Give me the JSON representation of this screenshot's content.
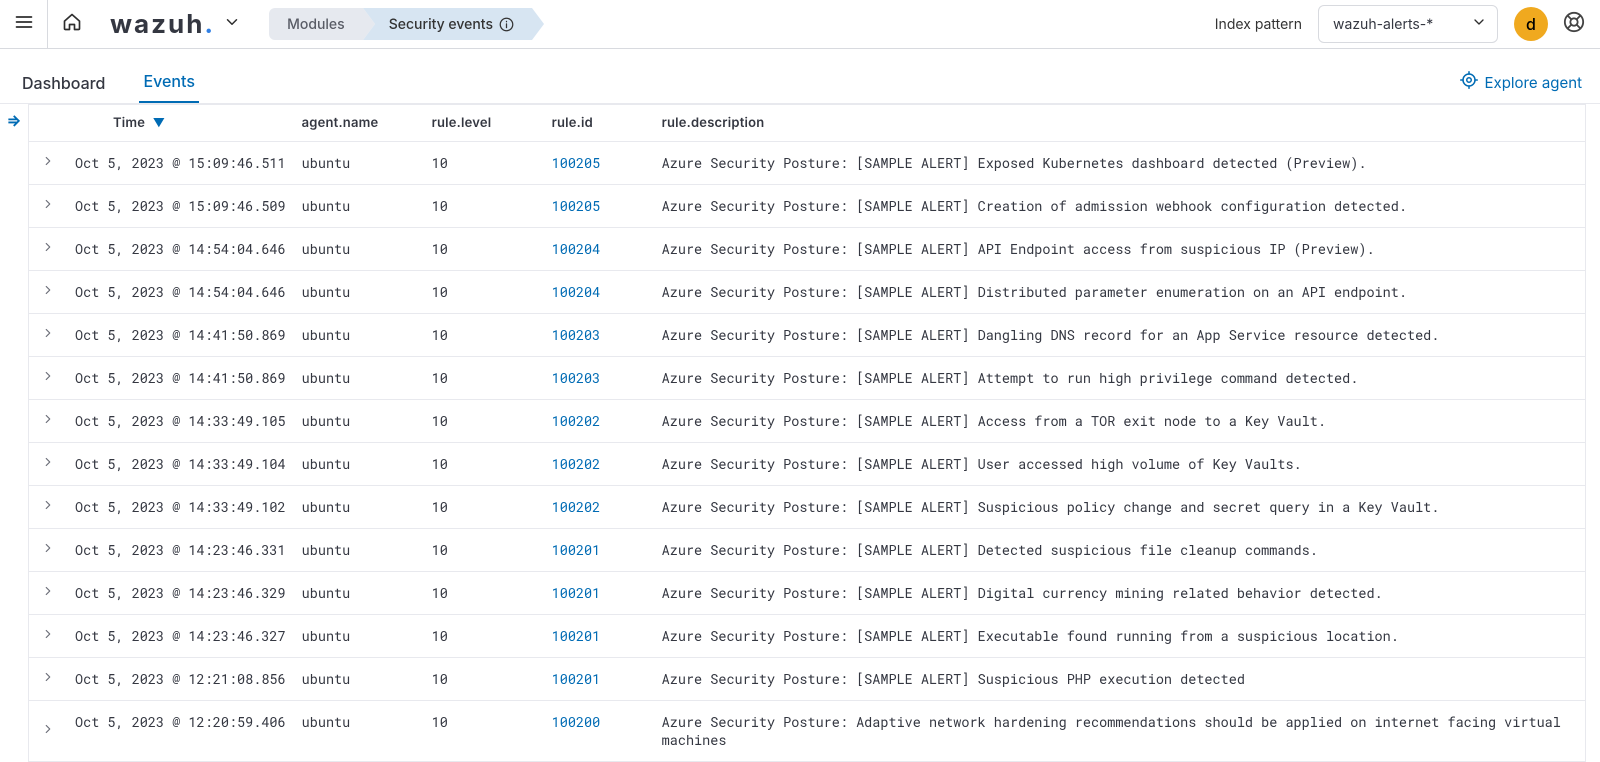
{
  "header": {
    "brand": "wazuh",
    "breadcrumbs": {
      "modules": "Modules",
      "page": "Security events"
    },
    "index_pattern_label": "Index pattern",
    "index_pattern_value": "wazuh-alerts-*",
    "avatar_initial": "d"
  },
  "tabs": {
    "dashboard": "Dashboard",
    "events": "Events",
    "explore": "Explore agent"
  },
  "table": {
    "columns": {
      "time": "Time",
      "agent_name": "agent.name",
      "rule_level": "rule.level",
      "rule_id": "rule.id",
      "rule_description": "rule.description"
    },
    "sort": {
      "column": "time",
      "direction": "desc"
    },
    "rows": [
      {
        "time": "Oct 5, 2023 @ 15:09:46.511",
        "agent_name": "ubuntu",
        "rule_level": "10",
        "rule_id": "100205",
        "rule_description": "Azure Security Posture: [SAMPLE ALERT] Exposed Kubernetes dashboard detected (Preview)."
      },
      {
        "time": "Oct 5, 2023 @ 15:09:46.509",
        "agent_name": "ubuntu",
        "rule_level": "10",
        "rule_id": "100205",
        "rule_description": "Azure Security Posture: [SAMPLE ALERT] Creation of admission webhook configuration detected."
      },
      {
        "time": "Oct 5, 2023 @ 14:54:04.646",
        "agent_name": "ubuntu",
        "rule_level": "10",
        "rule_id": "100204",
        "rule_description": "Azure Security Posture: [SAMPLE ALERT] API Endpoint access from suspicious IP (Preview)."
      },
      {
        "time": "Oct 5, 2023 @ 14:54:04.646",
        "agent_name": "ubuntu",
        "rule_level": "10",
        "rule_id": "100204",
        "rule_description": "Azure Security Posture: [SAMPLE ALERT] Distributed parameter enumeration on an API endpoint."
      },
      {
        "time": "Oct 5, 2023 @ 14:41:50.869",
        "agent_name": "ubuntu",
        "rule_level": "10",
        "rule_id": "100203",
        "rule_description": "Azure Security Posture: [SAMPLE ALERT] Dangling DNS record for an App Service resource detected."
      },
      {
        "time": "Oct 5, 2023 @ 14:41:50.869",
        "agent_name": "ubuntu",
        "rule_level": "10",
        "rule_id": "100203",
        "rule_description": "Azure Security Posture: [SAMPLE ALERT] Attempt to run high privilege command detected."
      },
      {
        "time": "Oct 5, 2023 @ 14:33:49.105",
        "agent_name": "ubuntu",
        "rule_level": "10",
        "rule_id": "100202",
        "rule_description": "Azure Security Posture: [SAMPLE ALERT] Access from a TOR exit node to a Key Vault."
      },
      {
        "time": "Oct 5, 2023 @ 14:33:49.104",
        "agent_name": "ubuntu",
        "rule_level": "10",
        "rule_id": "100202",
        "rule_description": "Azure Security Posture: [SAMPLE ALERT] User accessed high volume of Key Vaults."
      },
      {
        "time": "Oct 5, 2023 @ 14:33:49.102",
        "agent_name": "ubuntu",
        "rule_level": "10",
        "rule_id": "100202",
        "rule_description": "Azure Security Posture: [SAMPLE ALERT] Suspicious policy change and secret query in a Key Vault."
      },
      {
        "time": "Oct 5, 2023 @ 14:23:46.331",
        "agent_name": "ubuntu",
        "rule_level": "10",
        "rule_id": "100201",
        "rule_description": "Azure Security Posture: [SAMPLE ALERT]  Detected suspicious file cleanup commands."
      },
      {
        "time": "Oct 5, 2023 @ 14:23:46.329",
        "agent_name": "ubuntu",
        "rule_level": "10",
        "rule_id": "100201",
        "rule_description": "Azure Security Posture: [SAMPLE ALERT] Digital currency mining related behavior detected."
      },
      {
        "time": "Oct 5, 2023 @ 14:23:46.327",
        "agent_name": "ubuntu",
        "rule_level": "10",
        "rule_id": "100201",
        "rule_description": "Azure Security Posture: [SAMPLE ALERT] Executable found running from a suspicious location."
      },
      {
        "time": "Oct 5, 2023 @ 12:21:08.856",
        "agent_name": "ubuntu",
        "rule_level": "10",
        "rule_id": "100201",
        "rule_description": "Azure Security Posture: [SAMPLE ALERT]  Suspicious PHP execution detected"
      },
      {
        "time": "Oct 5, 2023 @ 12:20:59.406",
        "agent_name": "ubuntu",
        "rule_level": "10",
        "rule_id": "100200",
        "rule_description": "Azure Security Posture: Adaptive network hardening recommendations should be applied on internet facing virtual machines"
      }
    ]
  }
}
